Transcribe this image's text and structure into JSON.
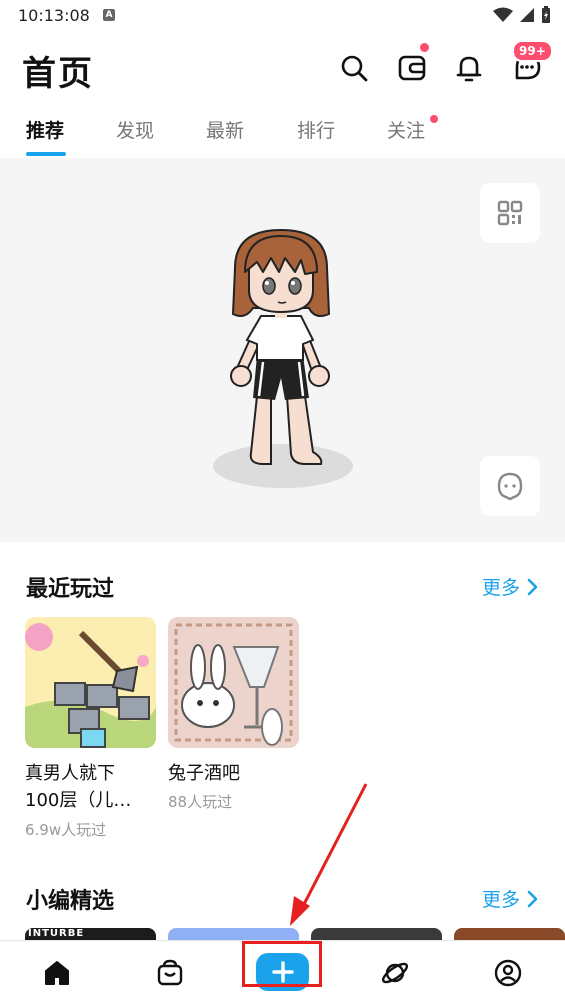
{
  "status": {
    "time": "10:13:08",
    "notification_glyph": "A"
  },
  "header": {
    "title": "首页",
    "message_badge": "99+"
  },
  "tabs": [
    {
      "label": "推荐"
    },
    {
      "label": "发现"
    },
    {
      "label": "最新"
    },
    {
      "label": "排行"
    },
    {
      "label": "关注"
    }
  ],
  "recent": {
    "title": "最近玩过",
    "more": "更多",
    "games": [
      {
        "name_line1": "真男人就下",
        "name_line2": "100层（儿…",
        "plays": "6.9w人玩过"
      },
      {
        "name_line1": "兔子酒吧",
        "plays": "88人玩过"
      }
    ]
  },
  "picks": {
    "title": "小编精选",
    "more": "更多",
    "first_card_text": "INTURBE"
  },
  "colors": {
    "accent": "#1aa3ea",
    "badge": "#ff4d6d",
    "annotation": "#e5201f"
  },
  "icons": [
    "search-icon",
    "wallet-icon",
    "bell-icon",
    "message-icon",
    "qr-code-icon",
    "avatar-face-icon",
    "home-icon",
    "shop-bag-icon",
    "plus-icon",
    "planet-icon",
    "profile-icon"
  ]
}
